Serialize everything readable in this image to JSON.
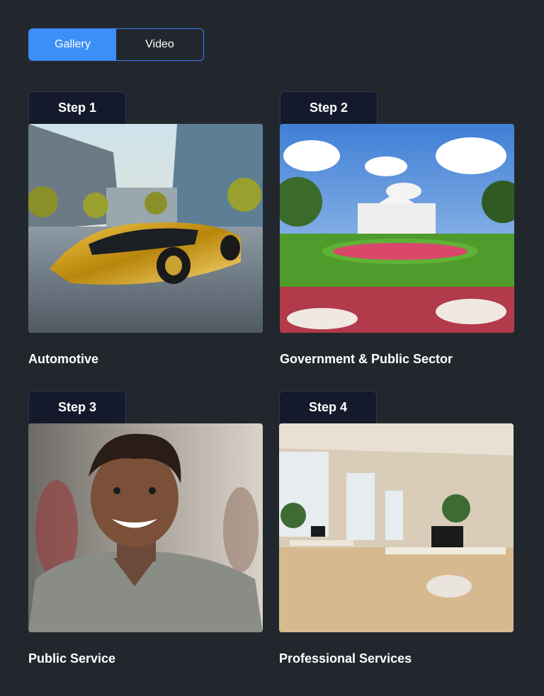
{
  "toggle": {
    "gallery_label": "Gallery",
    "video_label": "Video"
  },
  "cards": [
    {
      "step": "Step 1",
      "caption": "Automotive"
    },
    {
      "step": "Step 2",
      "caption": "Government & Public Sector"
    },
    {
      "step": "Step 3",
      "caption": "Public Service"
    },
    {
      "step": "Step 4",
      "caption": "Professional Services"
    }
  ],
  "colors": {
    "accent": "#3b8ff6",
    "background": "#22272e",
    "tab": "#141a2b"
  }
}
